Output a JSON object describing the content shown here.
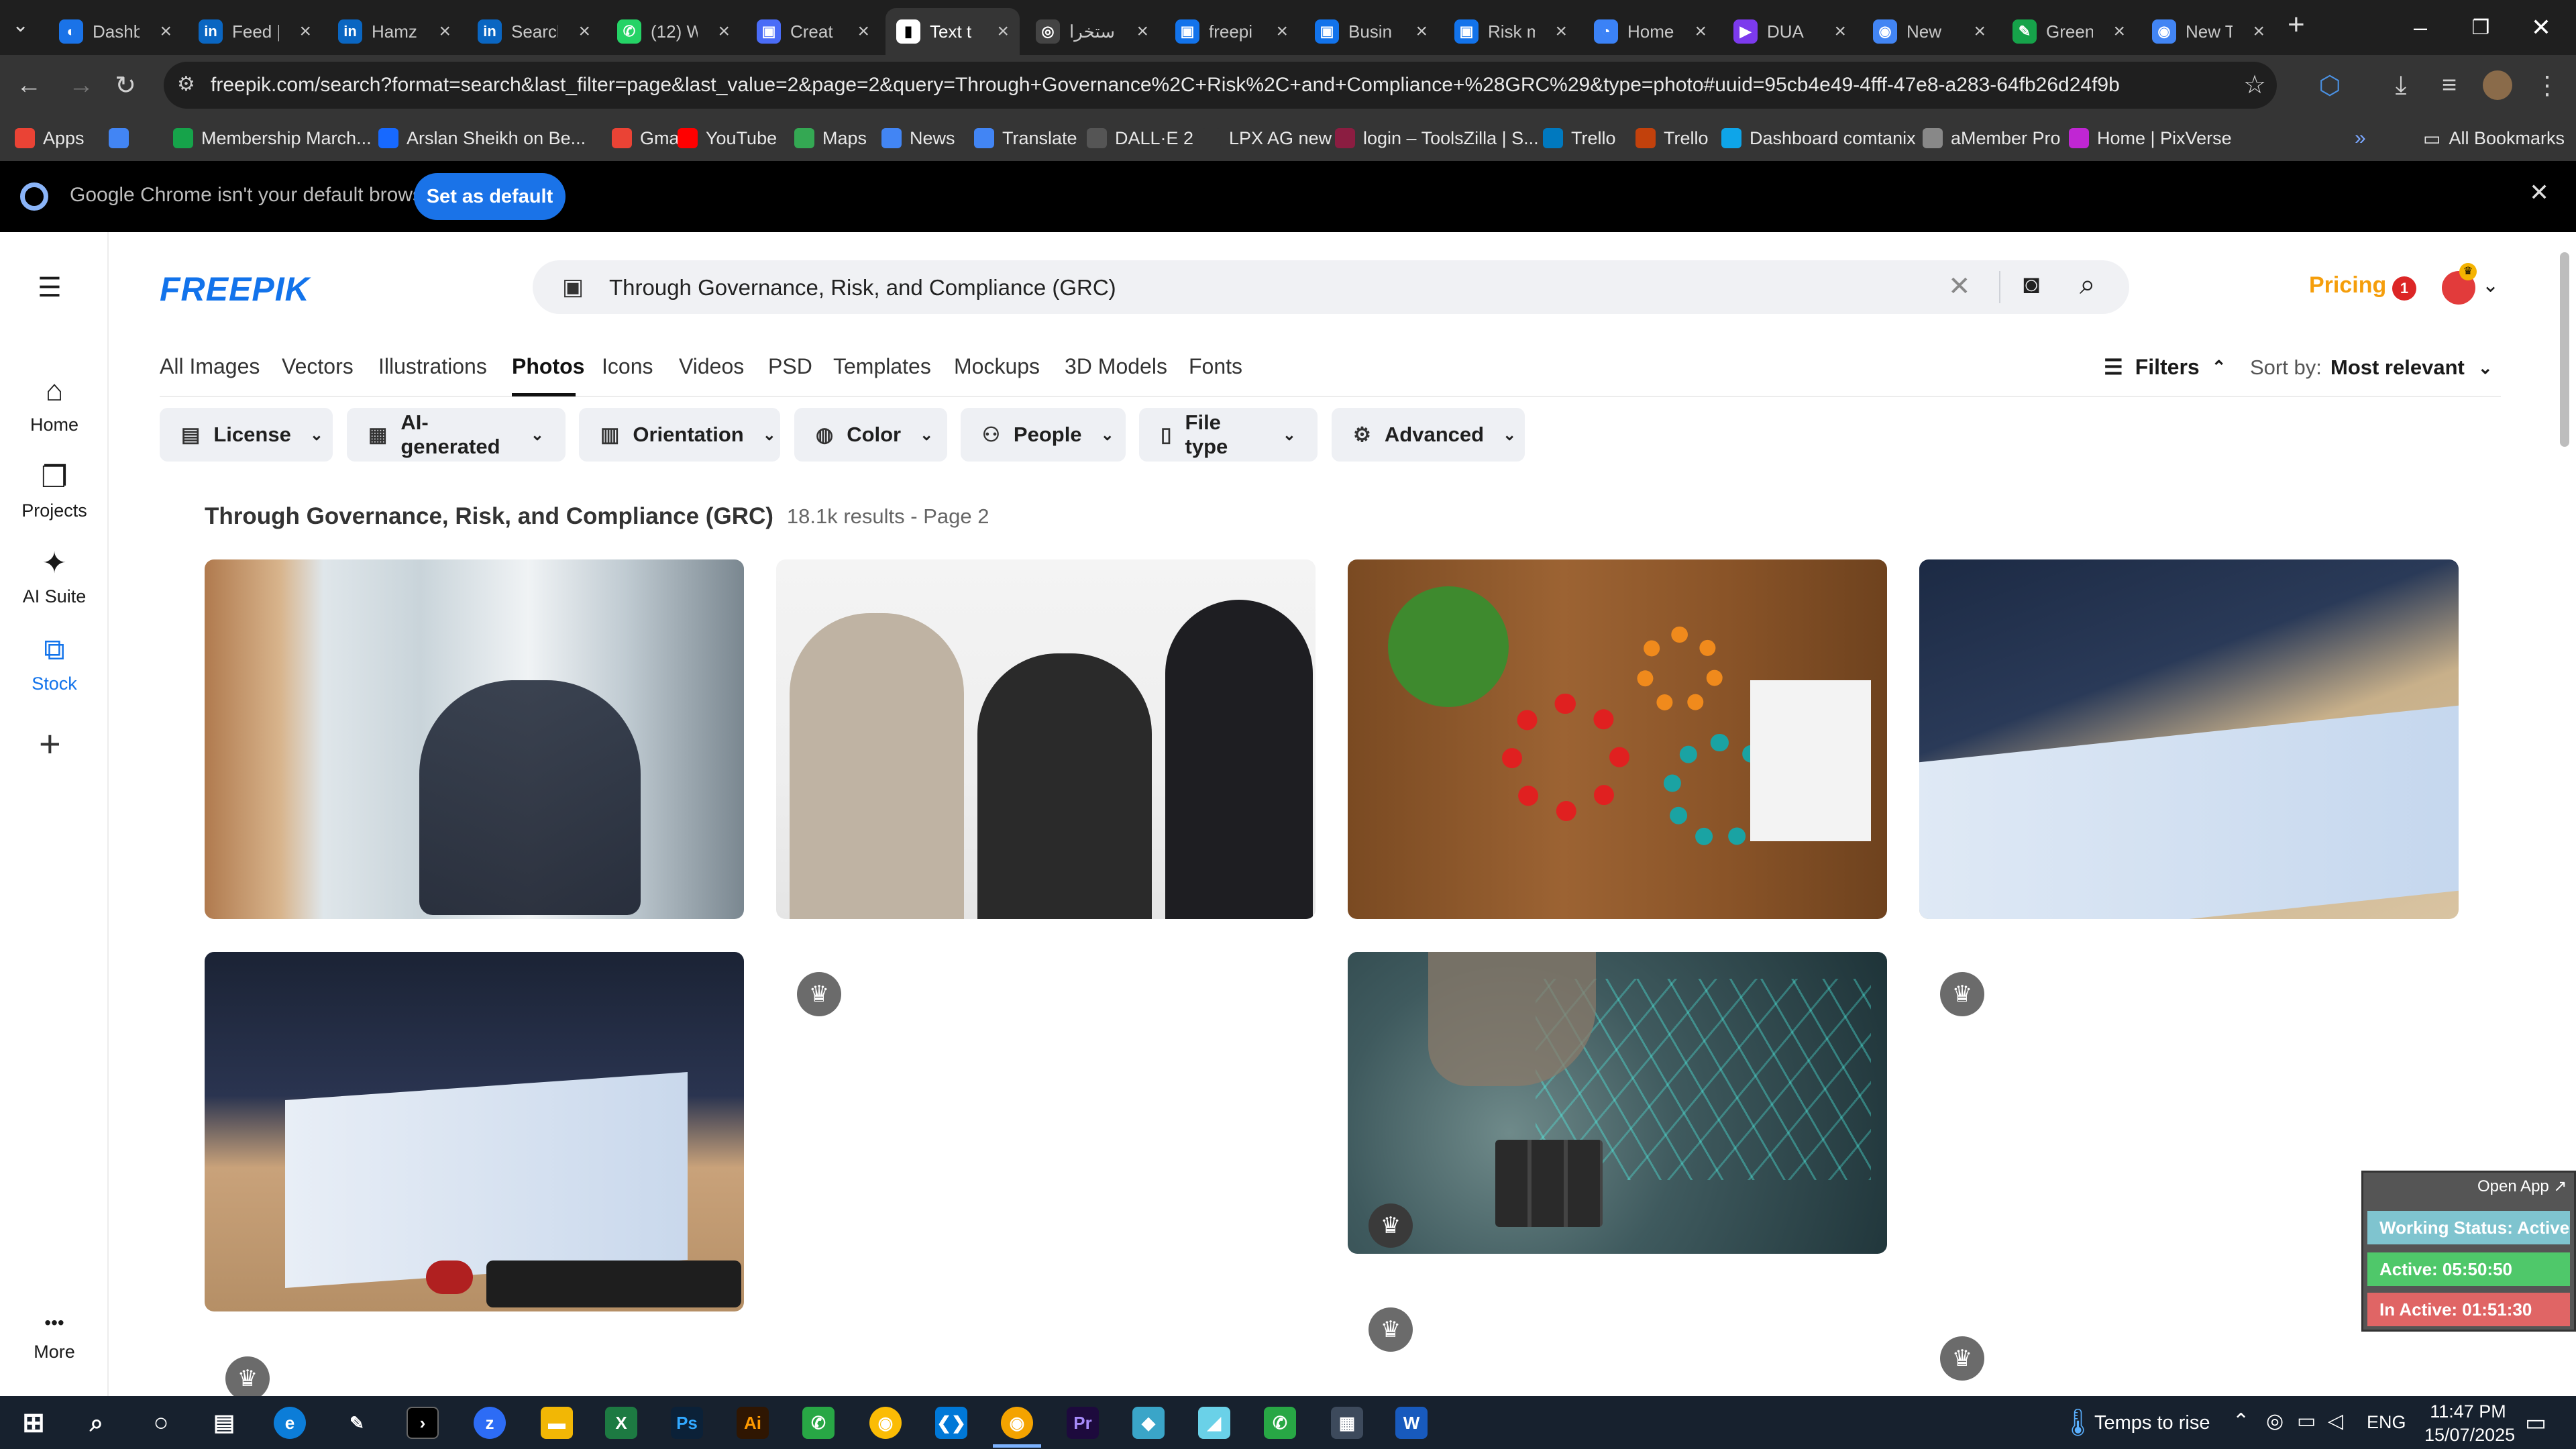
{
  "browser": {
    "tabs": [
      {
        "title": "Dashb",
        "color": "#1a73e8",
        "glyph": "◐"
      },
      {
        "title": "Feed |",
        "color": "#0a66c2",
        "glyph": "in"
      },
      {
        "title": "Hamz",
        "color": "#0a66c2",
        "glyph": "in"
      },
      {
        "title": "Search",
        "color": "#0a66c2",
        "glyph": "in"
      },
      {
        "title": "(12) W",
        "color": "#25d366",
        "glyph": "✆"
      },
      {
        "title": "Creat",
        "color": "#4a6cf7",
        "glyph": "▣"
      },
      {
        "title": "Text t",
        "color": "#ffffff",
        "glyph": "▮"
      },
      {
        "title": "استخرا",
        "color": "#444444",
        "glyph": "◎"
      },
      {
        "title": "freepi",
        "color": "#1273eb",
        "glyph": "▣"
      },
      {
        "title": "Busin",
        "color": "#1273eb",
        "glyph": "▣"
      },
      {
        "title": "Risk m",
        "color": "#1273eb",
        "glyph": "▣"
      },
      {
        "title": "Home",
        "color": "#3b82f6",
        "glyph": "◔"
      },
      {
        "title": "DUA",
        "color": "#7c3aed",
        "glyph": "▶"
      },
      {
        "title": "New",
        "color": "#4285f4",
        "glyph": "◉"
      },
      {
        "title": "Green",
        "color": "#16a34a",
        "glyph": "✎"
      },
      {
        "title": "New T",
        "color": "#4285f4",
        "glyph": "◉"
      }
    ],
    "url": "freepik.com/search?format=search&last_filter=page&last_value=2&page=2&query=Through+Governance%2C+Risk%2C+and+Compliance+%28GRC%29&type=photo#uuid=95cb4e49-4fff-47e8-a283-64fb26d24f9b",
    "bookmarks": [
      {
        "label": "Apps",
        "color": "#ea4335"
      },
      {
        "label": "",
        "color": "#4285f4"
      },
      {
        "label": "Membership March...",
        "color": "#16a34a"
      },
      {
        "label": "Arslan Sheikh on Be...",
        "color": "#1769ff"
      },
      {
        "label": "Gmail",
        "color": "#ea4335"
      },
      {
        "label": "YouTube",
        "color": "#ff0000"
      },
      {
        "label": "Maps",
        "color": "#34a853"
      },
      {
        "label": "News",
        "color": "#4285f4"
      },
      {
        "label": "Translate",
        "color": "#4285f4"
      },
      {
        "label": "DALL·E 2",
        "color": "#555555"
      },
      {
        "label": "LPX AG new",
        "color": "#353535"
      },
      {
        "label": "login – ToolsZilla | S...",
        "color": "#8b1d41"
      },
      {
        "label": "Trello",
        "color": "#0079bf"
      },
      {
        "label": "Trello",
        "color": "#c2410c"
      },
      {
        "label": "Dashboard comtanix",
        "color": "#0ea5e9"
      },
      {
        "label": "aMember Pro",
        "color": "#888888"
      },
      {
        "label": "Home | PixVerse",
        "color": "#c026d3"
      }
    ],
    "all_bookmarks": "All Bookmarks",
    "infobar": {
      "message": "Google Chrome isn't your default browser",
      "button": "Set as default"
    }
  },
  "freepik": {
    "logo": "FREEPIK",
    "search_query": "Through Governance, Risk, and Compliance (GRC)",
    "pricing": "Pricing",
    "notification_count": "1",
    "left_nav": [
      {
        "label": "Home",
        "icon": "⌂",
        "name": "home"
      },
      {
        "label": "Projects",
        "icon": "❐",
        "name": "projects"
      },
      {
        "label": "AI Suite",
        "icon": "✦",
        "name": "ai-suite"
      },
      {
        "label": "Stock",
        "icon": "⧉",
        "name": "stock"
      }
    ],
    "left_nav_plus": "+",
    "left_nav_more": {
      "icon": "•••",
      "label": "More"
    },
    "categories": [
      "All Images",
      "Vectors",
      "Illustrations",
      "Photos",
      "Icons",
      "Videos",
      "PSD",
      "Templates",
      "Mockups",
      "3D Models",
      "Fonts"
    ],
    "active_category": "Photos",
    "filters_label": "Filters",
    "sort_label": "Sort by:",
    "sort_value": "Most relevant",
    "filter_buttons": [
      {
        "label": "License",
        "icon": "▤"
      },
      {
        "label": "AI-generated",
        "icon": "▦"
      },
      {
        "label": "Orientation",
        "icon": "▥"
      },
      {
        "label": "Color",
        "icon": "◍"
      },
      {
        "label": "People",
        "icon": "⚇"
      },
      {
        "label": "File type",
        "icon": "▯"
      },
      {
        "label": "Advanced",
        "icon": "⚙"
      }
    ],
    "results_heading": "Through Governance, Risk, and Compliance (GRC)",
    "results_meta": "18.1k results - Page 2"
  },
  "tracker": {
    "open_app": "Open App ↗",
    "working_status": "Working Status: Active",
    "active": "Active: 05:50:50",
    "inactive": "In Active: 01:51:30"
  },
  "taskbar": {
    "weather": "Temps to rise",
    "language": "ENG",
    "time": "11:47 PM",
    "date": "15/07/2025"
  }
}
